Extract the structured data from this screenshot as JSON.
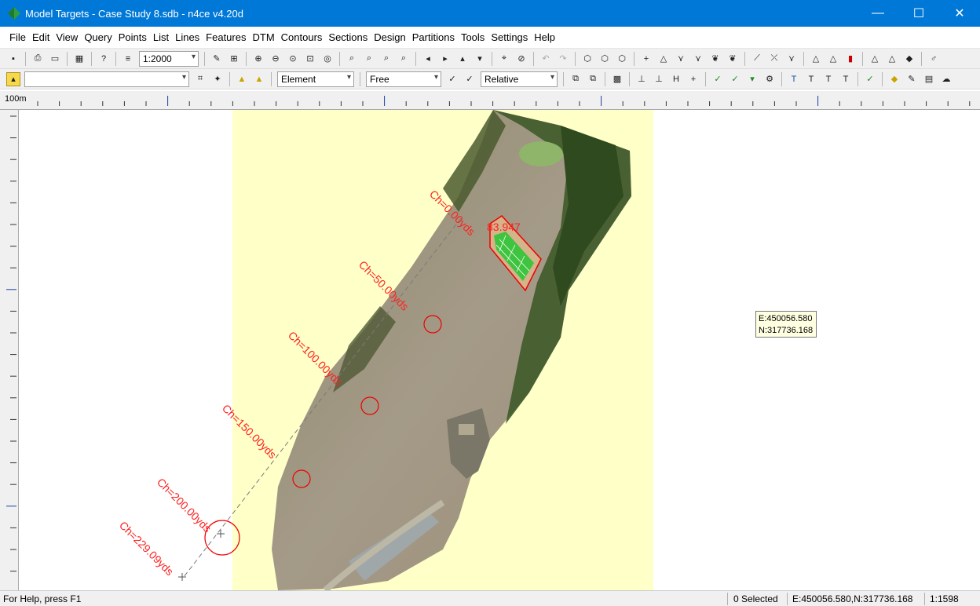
{
  "window": {
    "title": "Model Targets - Case Study 8.sdb - n4ce v4.20d",
    "min": "—",
    "max": "☐",
    "close": "✕"
  },
  "menu": [
    "File",
    "Edit",
    "View",
    "Query",
    "Points",
    "List",
    "Lines",
    "Features",
    "DTM",
    "Contours",
    "Sections",
    "Design",
    "Partitions",
    "Tools",
    "Settings",
    "Help"
  ],
  "toolbar1": {
    "scale_value": "1:2000"
  },
  "toolbar2": {
    "layer_value": "",
    "element_value": "Element",
    "free_value": "Free",
    "relative_value": "Relative"
  },
  "ruler": {
    "label": "100m"
  },
  "map": {
    "labels": [
      "Ch=0.00yds",
      "Ch=50.00yds",
      "Ch=100.00yds",
      "Ch=150.00yds",
      "Ch=200.00yds",
      "Ch=229.09yds"
    ],
    "value_label": "83.947",
    "tooltip": {
      "e": "E:450056.580",
      "n": "N:317736.168"
    }
  },
  "status": {
    "help": "For Help, press F1",
    "selected": "0 Selected",
    "coord": "E:450056.580,N:317736.168",
    "scale": "1:1598"
  }
}
